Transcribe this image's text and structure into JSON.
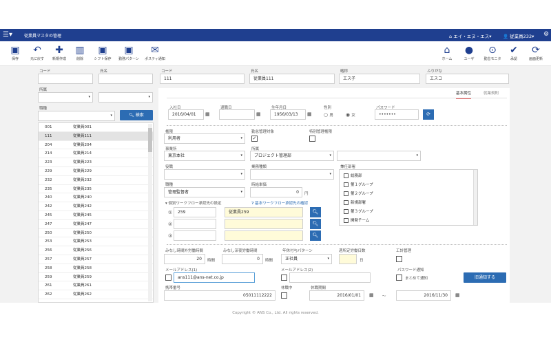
{
  "app": {
    "title": "従業員マスタの管理",
    "company": "エイ・エヌ・エス",
    "user": "従業員232"
  },
  "toolbar_left": [
    {
      "label": "保存",
      "icon": "save-icon",
      "glyph": "💾"
    },
    {
      "label": "元に戻す",
      "icon": "undo-icon",
      "glyph": "↶"
    },
    {
      "label": "新規作成",
      "icon": "plus-icon",
      "glyph": "✚"
    },
    {
      "label": "削除",
      "icon": "trash-icon",
      "glyph": "🗑"
    },
    {
      "label": "シフト保存",
      "icon": "save-shift-icon",
      "glyph": "💾"
    },
    {
      "label": "勤務パターン",
      "icon": "pattern-icon",
      "glyph": "💾"
    },
    {
      "label": "ポスティ通知",
      "icon": "mail-icon",
      "glyph": "✉"
    }
  ],
  "toolbar_right": [
    {
      "label": "ホーム",
      "icon": "home-icon",
      "glyph": "⌂"
    },
    {
      "label": "ユーザ",
      "icon": "user-icon",
      "glyph": "👤"
    },
    {
      "label": "勤怠モニタ",
      "icon": "binoculars-icon",
      "glyph": "⊙"
    },
    {
      "label": "承認",
      "icon": "check-icon",
      "glyph": "✔"
    },
    {
      "label": "画面更新",
      "icon": "refresh-icon",
      "glyph": "⟳"
    }
  ],
  "search": {
    "code_label": "コード",
    "name_label": "氏名",
    "position_label": "所属",
    "role_label": "職種",
    "search_button": "検索"
  },
  "list": [
    {
      "code": "001",
      "name": "従業員001"
    },
    {
      "code": "111",
      "name": "従業員111"
    },
    {
      "code": "204",
      "name": "従業員204"
    },
    {
      "code": "214",
      "name": "従業員214"
    },
    {
      "code": "223",
      "name": "従業員223"
    },
    {
      "code": "229",
      "name": "従業員229"
    },
    {
      "code": "232",
      "name": "従業員232"
    },
    {
      "code": "235",
      "name": "従業員235"
    },
    {
      "code": "240",
      "name": "従業員240"
    },
    {
      "code": "242",
      "name": "従業員242"
    },
    {
      "code": "245",
      "name": "従業員245"
    },
    {
      "code": "247",
      "name": "従業員247"
    },
    {
      "code": "250",
      "name": "従業員250"
    },
    {
      "code": "253",
      "name": "従業員253"
    },
    {
      "code": "256",
      "name": "従業員256"
    },
    {
      "code": "257",
      "name": "従業員257"
    },
    {
      "code": "258",
      "name": "従業員258"
    },
    {
      "code": "259",
      "name": "従業員259"
    },
    {
      "code": "261",
      "name": "従業員261"
    },
    {
      "code": "262",
      "name": "従業員262"
    }
  ],
  "header": {
    "code_label": "コード",
    "code": "111",
    "name_label": "氏名",
    "name": "従業員111",
    "short_label": "略称",
    "short": "エス子",
    "kana_label": "ふりがな",
    "kana": "エスコ"
  },
  "tabs": {
    "basic": "基本属性",
    "work_rules": "就業規則"
  },
  "basic": {
    "join_label": "入社日",
    "join": "2016/04/01",
    "leave_label": "退職日",
    "leave": "",
    "birth_label": "生年月日",
    "birth": "1956/03/13",
    "gender_label": "性別",
    "male": "男",
    "female": "女",
    "password_label": "パスワード",
    "password": "•••••••",
    "role_label": "権限",
    "role": "利用者",
    "attendance_label": "勤怠管理対象",
    "special_label": "特別管理権限",
    "office_label": "事業所",
    "office": "東京本社",
    "dept_label": "所属",
    "dept": "プロジェクト管理部",
    "position_label": "役職",
    "work_type_label": "業務種類",
    "concurrent_label": "兼任部署",
    "duty_label": "職種",
    "duty": "管理監督者",
    "wage_label": "時給単価",
    "wage": "0",
    "wage_unit": "円",
    "workflow_label": "個別ワークフロー承認先の設定",
    "workflow_link": "基本ワークフロー承認先の確認",
    "wf": [
      {
        "num": "①",
        "code": "259",
        "name": "従業員259"
      },
      {
        "num": "②",
        "code": "",
        "name": ""
      },
      {
        "num": "③",
        "code": "",
        "name": ""
      }
    ],
    "depts": [
      "総務部",
      "第１グループ",
      "第２グループ",
      "新規部署",
      "第３グループ",
      "開発チーム"
    ],
    "deemed_label": "みなし時間外労働時間",
    "deemed": "20",
    "deemed_unit": "時間",
    "deemed_night_label": "みなし深夜労働時間",
    "deemed_night": "0",
    "deemed_night_unit": "時間",
    "pattern_label": "年休付与パターン",
    "pattern": "正社員",
    "schedule_label": "週所定労働日数",
    "schedule_unit": "日",
    "factory_label": "工計管理",
    "email1_label": "メールアドレス(1)",
    "email1": "ans111@ans-net.co.jp",
    "email2_label": "メールアドレス(2)",
    "pw_notify_label": "パスワード通知",
    "pw_notify_opt": "まとめて通知",
    "notify_button": "旧通知する",
    "phone_label": "携帯番号",
    "phone": "05011112222",
    "leave_flag_label": "休職中",
    "leave_period_label": "休職期間",
    "leave_from": "2016/01/01",
    "tilde": "～",
    "leave_to": "2016/11/30"
  },
  "footer": "Copyright © ANS Co., Ltd. All rights reserved."
}
